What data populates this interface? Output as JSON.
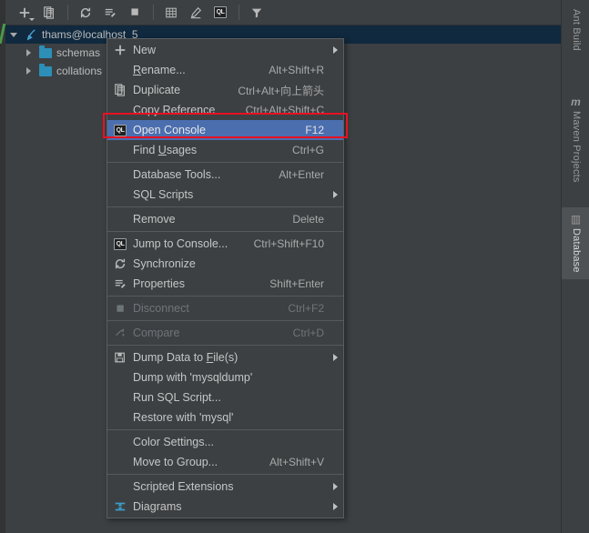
{
  "toolbar": {
    "buttons": [
      {
        "name": "add-button",
        "icon": "plus-icon"
      },
      {
        "name": "copy-datasource-button",
        "icon": "duplicate-icon"
      },
      {
        "name": "separator-1",
        "icon": "separator"
      },
      {
        "name": "synchronize-button",
        "icon": "refresh-icon"
      },
      {
        "name": "properties-button",
        "icon": "properties-icon"
      },
      {
        "name": "stop-button",
        "icon": "stop-square-icon"
      },
      {
        "name": "separator-2",
        "icon": "separator"
      },
      {
        "name": "table-editor-button",
        "icon": "table-grid-icon"
      },
      {
        "name": "modify-button",
        "icon": "pencil-icon"
      },
      {
        "name": "open-console-button",
        "icon": "sql-console-icon"
      },
      {
        "name": "separator-3",
        "icon": "separator"
      },
      {
        "name": "filter-button",
        "icon": "filter-funnel-icon"
      }
    ],
    "sql_icon_text": "QL"
  },
  "tree": {
    "rows": [
      {
        "label": "thams@localhost_5",
        "icon": "datasource-icon",
        "expanded": true,
        "selected": true,
        "indent": 0
      },
      {
        "label": "schemas",
        "icon": "folder-icon",
        "expanded": false,
        "selected": false,
        "indent": 1
      },
      {
        "label": "collations",
        "icon": "folder-icon",
        "expanded": false,
        "selected": false,
        "indent": 1
      }
    ]
  },
  "right_bar": {
    "items": [
      {
        "label": "Ant Build",
        "icon": "ant-build-icon",
        "active": false
      },
      {
        "label": "Maven Projects",
        "icon": "maven-icon",
        "active": false
      },
      {
        "label": "Database",
        "icon": "database-icon",
        "active": true
      }
    ],
    "maven_glyph": "m",
    "database_glyph": "▥"
  },
  "context_menu": {
    "items": [
      {
        "label": "New",
        "accel": "",
        "icon": "plus-icon",
        "submenu": true,
        "disabled": false,
        "highlight": false,
        "mnemonic": ""
      },
      {
        "label": "Rename...",
        "accel": "Alt+Shift+R",
        "icon": "",
        "submenu": false,
        "disabled": false,
        "highlight": false,
        "mnemonic": "R"
      },
      {
        "label": "Duplicate",
        "accel": "Ctrl+Alt+向上箭头",
        "icon": "duplicate-icon",
        "submenu": false,
        "disabled": false,
        "highlight": false,
        "mnemonic": ""
      },
      {
        "label": "Copy Reference",
        "accel": "Ctrl+Alt+Shift+C",
        "icon": "",
        "submenu": false,
        "disabled": false,
        "highlight": false,
        "mnemonic": ""
      },
      {
        "label": "Open Console",
        "accel": "F12",
        "icon": "sql-console-icon",
        "submenu": false,
        "disabled": false,
        "highlight": true,
        "mnemonic": ""
      },
      {
        "label": "Find Usages",
        "accel": "Ctrl+G",
        "icon": "",
        "submenu": false,
        "disabled": false,
        "highlight": false,
        "mnemonic": "U"
      },
      {
        "separator": true
      },
      {
        "label": "Database Tools...",
        "accel": "Alt+Enter",
        "icon": "",
        "submenu": false,
        "disabled": false,
        "highlight": false,
        "mnemonic": ""
      },
      {
        "label": "SQL Scripts",
        "accel": "",
        "icon": "",
        "submenu": true,
        "disabled": false,
        "highlight": false,
        "mnemonic": ""
      },
      {
        "separator": true
      },
      {
        "label": "Remove",
        "accel": "Delete",
        "icon": "",
        "submenu": false,
        "disabled": false,
        "highlight": false,
        "mnemonic": ""
      },
      {
        "separator": true
      },
      {
        "label": "Jump to Console...",
        "accel": "Ctrl+Shift+F10",
        "icon": "sql-console-icon",
        "submenu": false,
        "disabled": false,
        "highlight": false,
        "mnemonic": ""
      },
      {
        "label": "Synchronize",
        "accel": "",
        "icon": "refresh-icon",
        "submenu": false,
        "disabled": false,
        "highlight": false,
        "mnemonic": ""
      },
      {
        "label": "Properties",
        "accel": "Shift+Enter",
        "icon": "properties-icon",
        "submenu": false,
        "disabled": false,
        "highlight": false,
        "mnemonic": ""
      },
      {
        "separator": true
      },
      {
        "label": "Disconnect",
        "accel": "Ctrl+F2",
        "icon": "stop-square-icon",
        "submenu": false,
        "disabled": true,
        "highlight": false,
        "mnemonic": ""
      },
      {
        "separator": true
      },
      {
        "label": "Compare",
        "accel": "Ctrl+D",
        "icon": "compare-icon",
        "submenu": false,
        "disabled": true,
        "highlight": false,
        "mnemonic": ""
      },
      {
        "separator": true
      },
      {
        "label": "Dump Data to File(s)",
        "accel": "",
        "icon": "save-floppy-icon",
        "submenu": true,
        "disabled": false,
        "highlight": false,
        "mnemonic": "F"
      },
      {
        "label": "Dump with 'mysqldump'",
        "accel": "",
        "icon": "",
        "submenu": false,
        "disabled": false,
        "highlight": false,
        "mnemonic": ""
      },
      {
        "label": "Run SQL Script...",
        "accel": "",
        "icon": "",
        "submenu": false,
        "disabled": false,
        "highlight": false,
        "mnemonic": ""
      },
      {
        "label": "Restore with 'mysql'",
        "accel": "",
        "icon": "",
        "submenu": false,
        "disabled": false,
        "highlight": false,
        "mnemonic": ""
      },
      {
        "separator": true
      },
      {
        "label": "Color Settings...",
        "accel": "",
        "icon": "",
        "submenu": false,
        "disabled": false,
        "highlight": false,
        "mnemonic": ""
      },
      {
        "label": "Move to Group...",
        "accel": "Alt+Shift+V",
        "icon": "",
        "submenu": false,
        "disabled": false,
        "highlight": false,
        "mnemonic": ""
      },
      {
        "separator": true
      },
      {
        "label": "Scripted Extensions",
        "accel": "",
        "icon": "",
        "submenu": true,
        "disabled": false,
        "highlight": false,
        "mnemonic": ""
      },
      {
        "label": "Diagrams",
        "accel": "",
        "icon": "diagram-icon",
        "submenu": true,
        "disabled": false,
        "highlight": false,
        "mnemonic": ""
      }
    ]
  },
  "annotation": {
    "highlight_color": "#e81123",
    "target_label": "Open Console"
  },
  "colors": {
    "panel_bg": "#3c4043",
    "menu_bg": "#3c4043",
    "menu_border": "#5a5e61",
    "selection_blue": "#4b6eaf",
    "tree_selection": "#10293e",
    "text": "#c6c6c6",
    "disabled_text": "#6f7477",
    "accent_folder": "#2d8fb8"
  }
}
